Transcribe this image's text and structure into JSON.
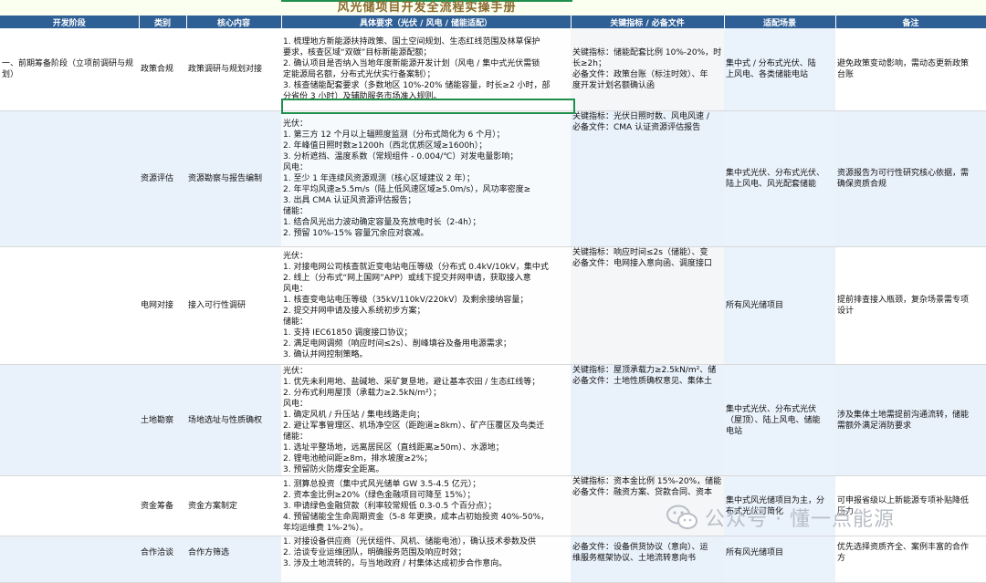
{
  "title": "风光储项目开发全流程实操手册",
  "headers": [
    "开发阶段",
    "类别",
    "核心内容",
    "具体要求（光伏 / 风电 / 储能适配）",
    "关键指标 / 必备文件",
    "适配场景",
    "备注"
  ],
  "rows": [
    {
      "stage": "一、前期筹备阶段（立项前调研与规划）",
      "category": "政策合规",
      "core": "政策调研与规划对接",
      "req": [
        "1. 梳理地方新能源扶持政策、国土空间规划、生态红线范围及林草保护",
        "要求，核查区域“双碳”目标新能源配额；",
        "2. 确认项目是否纳入当地年度新能源开发计划（风电 / 集中式光伏需锁",
        "定能源局名额，分布式光伏实行备案制）；",
        "3. 核查储能配套要求（多数地区 10%-20% 储能容量，时长≥2 小时，部",
        "分省份 3 小时）及辅助服务市场准入规则。"
      ],
      "kpi": [
        "关键指标：储能配套比例 10%-20%，时",
        "长≥2h；",
        "必备文件：政策台账（标注时效）、年",
        "度开发计划名额确认函"
      ],
      "scene": [
        "集中式 / 分布式光伏、陆",
        "上风电、各类储能电站"
      ],
      "note": [
        "避免政策变动影响，需动态更新政策",
        "台账"
      ]
    },
    {
      "stage": "",
      "category": "资源评估",
      "core": "资源勘察与报告编制",
      "req": [
        "光伏：",
        "1. 第三方 12 个月以上辐照度监测（分布式简化为 6 个月）；",
        "2. 年峰值日照时数≥1200h（西北优质区域≥1600h）；",
        "3. 分析遮挡、温度系数（常规组件 - 0.004/℃）对发电量影响；",
        "风电：",
        "1. 至少 1 年连续风资源观测（核心区域建议 2 年）；",
        "2. 年平均风速≥5.5m/s（陆上低风速区域≥5.0m/s），风功率密度≥",
        "3. 出具 CMA 认证风资源评估报告；",
        "储能：",
        "1. 结合风光出力波动确定容量及充放电时长（2-4h）；",
        "2. 预留 10%-15% 容量冗余应对衰减。"
      ],
      "kpi": [
        "关键指标：光伏日照时数、风电风速 /",
        "必备文件：CMA 认证资源评估报告"
      ],
      "scene": [
        "集中式光伏、分布式光伏、",
        "陆上风电、风光配套储能"
      ],
      "note": [
        "资源报告为可行性研究核心依据，需",
        "确保资质合规"
      ]
    },
    {
      "stage": "",
      "category": "电网对接",
      "core": "接入可行性调研",
      "req": [
        "光伏：",
        "1. 对接电网公司核查就近变电站电压等级（分布式 0.4kV/10kV，集中式",
        "2. 线上（分布式“网上国网”APP）或线下提交并网申请，获取接入意",
        "风电：",
        "1. 核查变电站电压等级（35kV/110kV/220kV）及剩余接纳容量；",
        "2. 提交并网申请及接入系统初步方案；",
        "储能：",
        "1. 支持 IEC61850 调度接口协议；",
        "2. 满足电网调频（响应时间≤2s）、削峰填谷及备用电源需求；",
        "3. 确认并网控制策略。"
      ],
      "kpi": [
        "关键指标：响应时间≤2s（储能）、变",
        "必备文件：电网接入意向函、调度接口"
      ],
      "scene": [
        "所有风光储项目"
      ],
      "note": [
        "提前排查接入瓶颈，复杂场景需专项",
        "设计"
      ]
    },
    {
      "stage": "",
      "category": "土地勘察",
      "core": "场地选址与性质确权",
      "req": [
        "光伏：",
        "1. 优先未利用地、盐碱地、采矿复垦地，避让基本农田 / 生态红线等；",
        "2. 分布式利用屋顶（承载力≥2.5kN/m²）；",
        "风电：",
        "1. 确定风机 / 升压站 / 集电线路走向；",
        "2. 避让军事管理区、机场净空区（距跑道≥8km）、矿产压覆区及鸟类迁",
        "储能：",
        "1. 选址平整场地，远离居民区（直线距离≥50m）、水源地；",
        "2. 锂电池舱间距≥8m，排水坡度≥2%；",
        "3. 预留防火防爆安全距离。"
      ],
      "kpi": [
        "关键指标：屋顶承载力≥2.5kN/m²、储",
        "必备文件：土地性质确权意见、集体土"
      ],
      "scene": [
        "集中式光伏、分布式光伏",
        "（屋顶）、陆上风电、储能",
        "电站"
      ],
      "note": [
        "涉及集体土地需提前沟通流转，储能",
        "需额外满足消防要求"
      ]
    },
    {
      "stage": "",
      "category": "资金筹备",
      "core": "资金方案制定",
      "req": [
        "1. 测算总投资（集中式风光储单 GW 3.5-4.5 亿元）；",
        "2. 资本金比例≥20%（绿色金融项目可降至 15%）；",
        "3. 申请绿色金融贷款（利率较常规低 0.3-0.5 个百分点）；",
        "4. 预留储能全生命周期资金（5-8 年更换，成本占初始投资 40%-50%，",
        "年均运维费 1%-2%）。"
      ],
      "kpi": [
        "关键指标：资本金比例 15%-20%，储能",
        "必备文件：融资方案、贷款合同、资本"
      ],
      "scene": [
        "集中式风光储项目为主，分",
        "布式光伏可简化"
      ],
      "note": [
        "可申报省级以上新能源专项补贴降低",
        "压力"
      ]
    },
    {
      "stage": "",
      "category": "合作洽谈",
      "core": "合作方筛选",
      "req": [
        "1. 对接设备供应商（光伏组件、风机、储能电池），确认技术参数及供",
        "2. 洽谈专业运维团队，明确服务范围及响应时效；",
        "3. 涉及土地流转的，与当地政府 / 村集体达成初步合作意向。"
      ],
      "kpi": [
        "必备文件：设备供货协议（意向）、运",
        "维服务框架协议、土地流转意向书"
      ],
      "scene": [
        "所有风光储项目"
      ],
      "note": [
        "优先选择资质齐全、案例丰富的合作",
        "方"
      ]
    }
  ],
  "watermark": "公众号 · 懂一点能源",
  "colors": {
    "header_bg": "#2e5f95",
    "band": "#e9f1fb",
    "title": "#8a6a2f",
    "selection": "#1f8f4e"
  }
}
